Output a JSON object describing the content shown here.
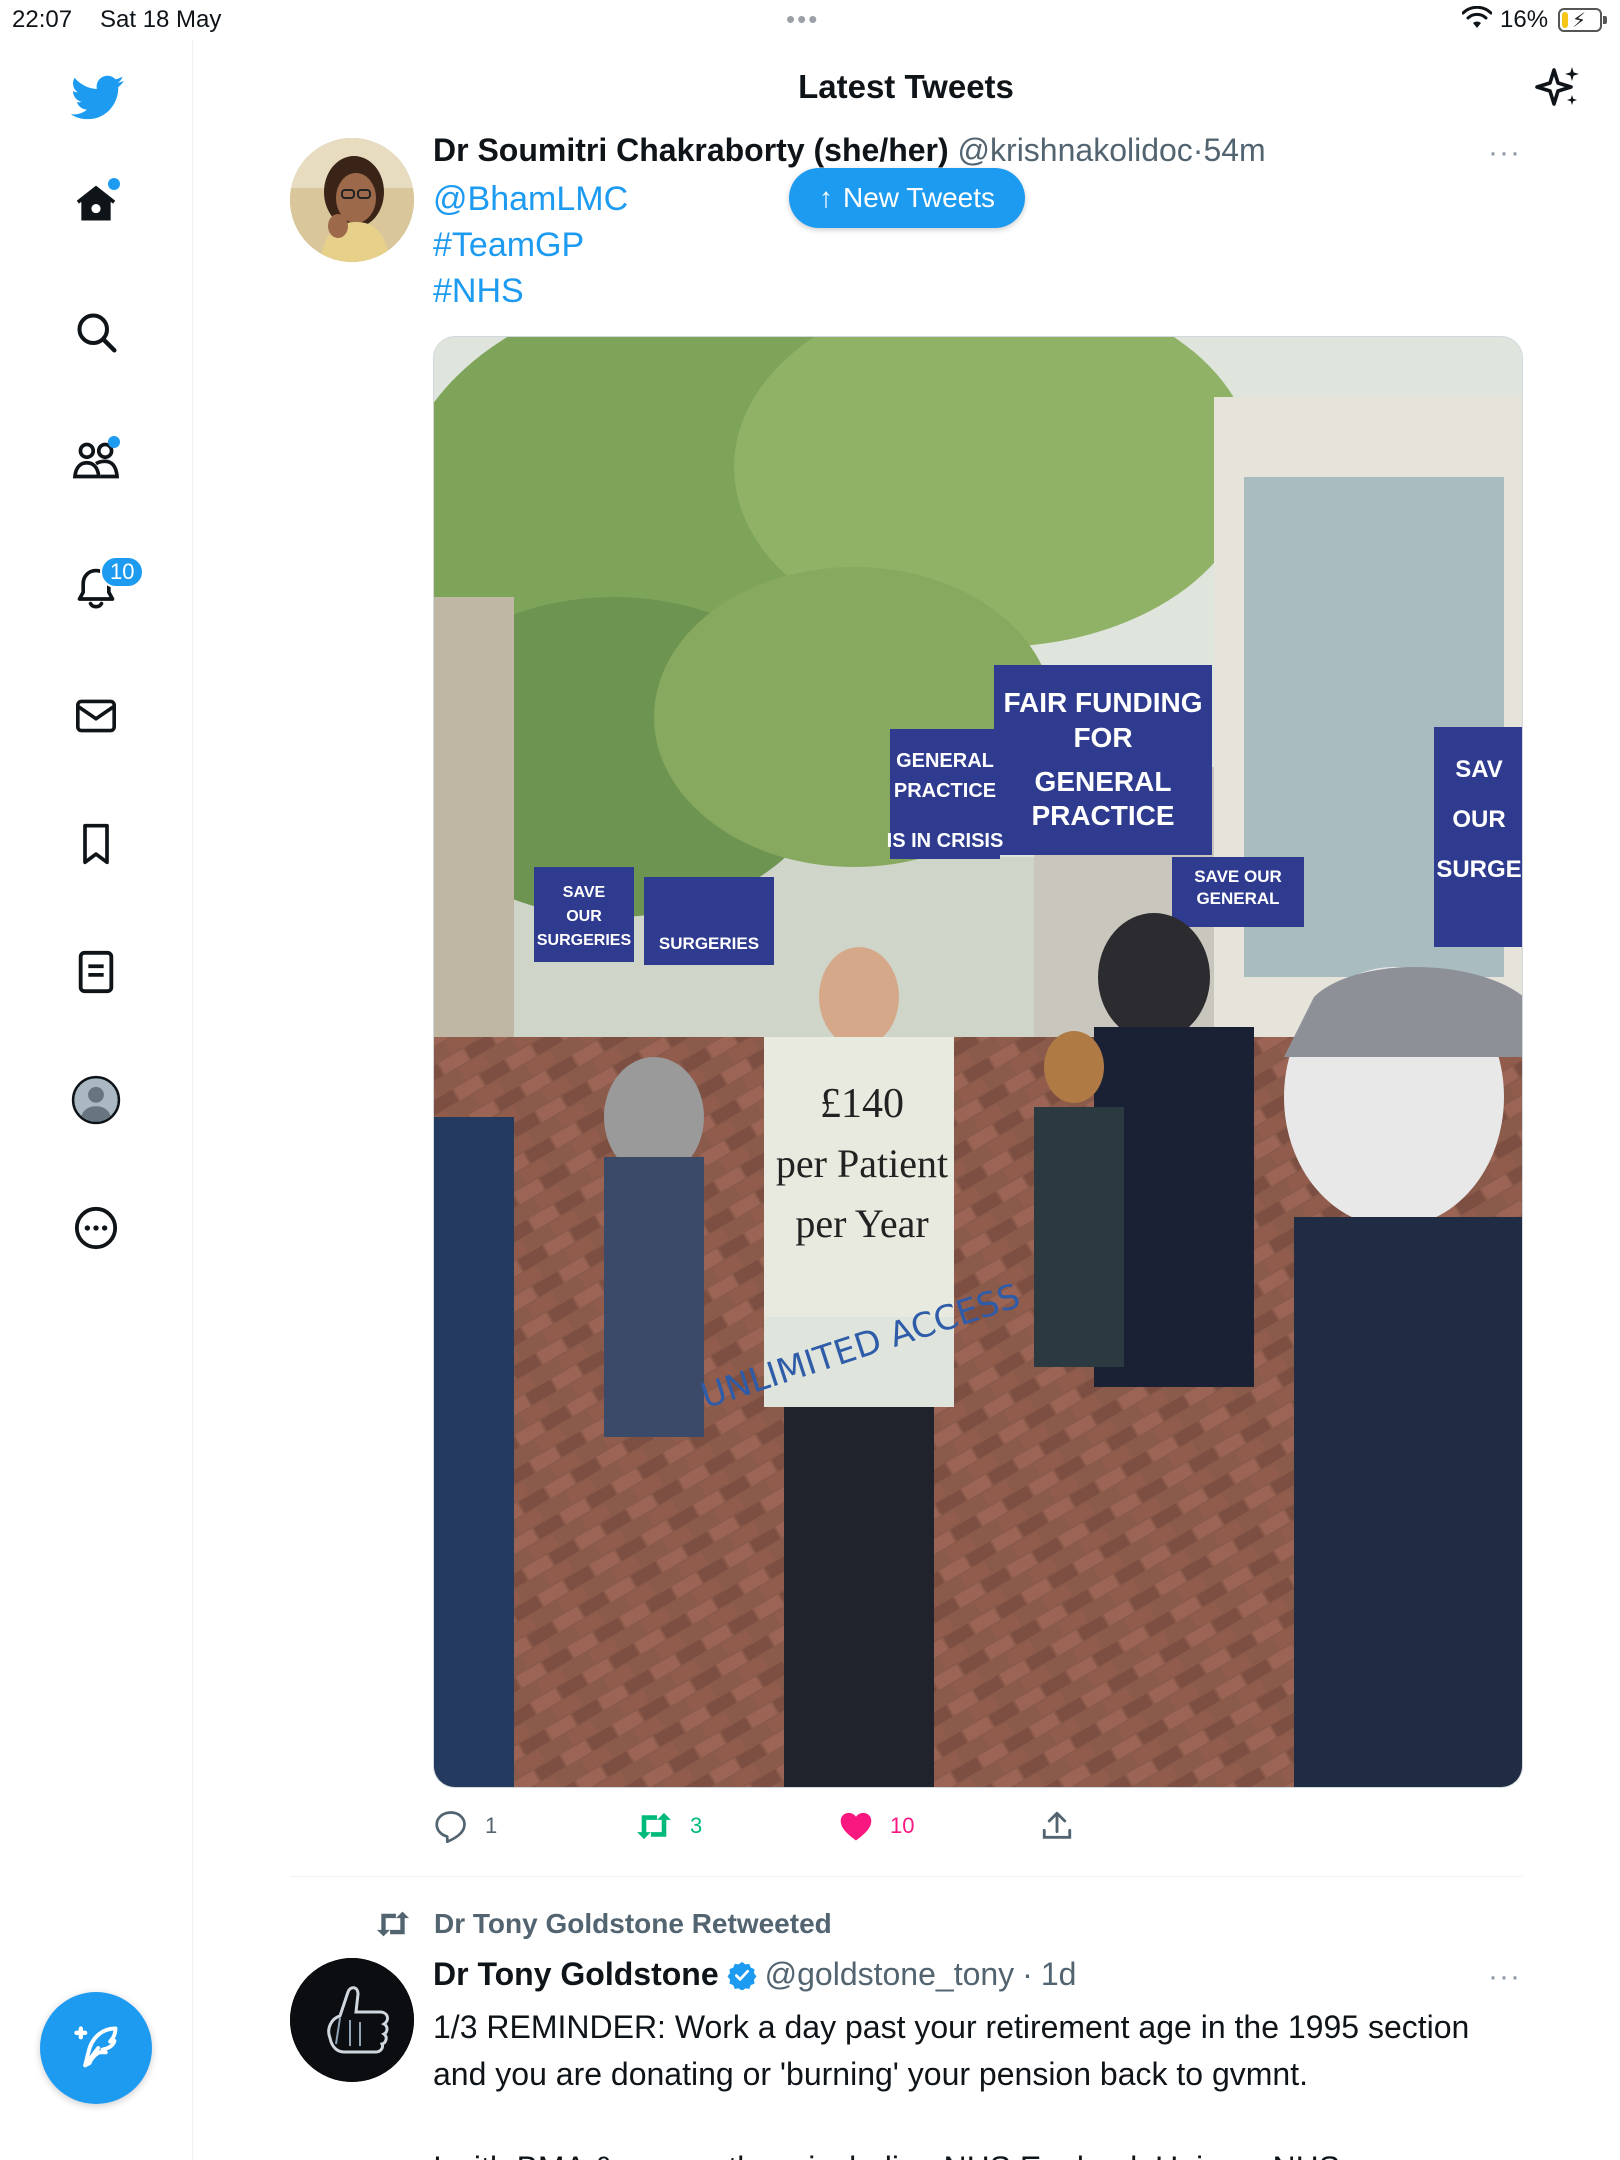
{
  "status_bar": {
    "time": "22:07",
    "date": "Sat 18 May",
    "battery": "16%",
    "battery_level": 0.16,
    "charging": true
  },
  "sidebar": {
    "items": [
      {
        "name": "home",
        "icon": "home-icon",
        "has_dot": true
      },
      {
        "name": "explore",
        "icon": "search-icon"
      },
      {
        "name": "communities",
        "icon": "people-icon",
        "has_dot": true
      },
      {
        "name": "notifications",
        "icon": "bell-icon",
        "badge": "10"
      },
      {
        "name": "messages",
        "icon": "mail-icon"
      },
      {
        "name": "bookmarks",
        "icon": "bookmark-icon"
      },
      {
        "name": "lists",
        "icon": "list-icon"
      },
      {
        "name": "profile",
        "icon": "profile-icon"
      },
      {
        "name": "more",
        "icon": "more-circle-icon"
      }
    ],
    "compose_icon": "compose-feather-icon"
  },
  "header": {
    "title": "Latest Tweets",
    "right_icon": "sparkle-icon"
  },
  "new_tweets_pill": {
    "arrow": "↑",
    "label": "New Tweets"
  },
  "tweets": [
    {
      "author_name": "Dr Soumitri Chakraborty (she/her)",
      "handle": "@krishnakolidoc",
      "separator": "·",
      "time": "54m",
      "text_lines": [
        "@BhamLMC",
        "#TeamGP",
        "#NHS"
      ],
      "image_text": {
        "sign_main": "FAIR FUNDING FOR GENERAL PRACTICE",
        "sign_left": "SAVE OUR SURGERIES",
        "sign_crisis": "GENERAL PRACTICE IS IN CRISIS",
        "sign_general": "SAVE OUR GENERAL",
        "sign_right": "SAVE OUR SURGERIES",
        "placard_line1": "£140",
        "placard_line2": "per Patient",
        "placard_line3": "per Year",
        "placard_handwritten": "UNLIMITED ACCESS"
      },
      "stats": {
        "replies": "1",
        "retweets": "3",
        "likes": "10"
      },
      "more": "···"
    },
    {
      "retweeted_by": "Dr Tony Goldstone Retweeted",
      "author_name": "Dr Tony Goldstone",
      "handle": "@goldstone_tony",
      "separator": "·",
      "time": "1d",
      "verified": true,
      "body_line1": "1/3 REMINDER: Work a day past your retirement age in the 1995 section and you are donating or 'burning' your pension back to gvmnt.",
      "body_line2": "I with BMA & many others including NHS England, Unison, NHS",
      "more": "···"
    }
  ]
}
